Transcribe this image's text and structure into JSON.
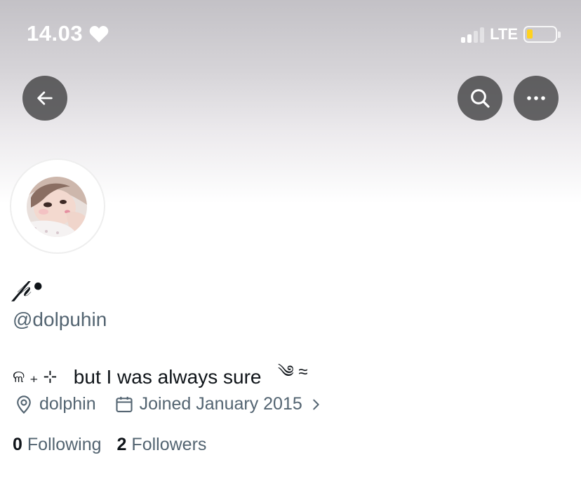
{
  "status_bar": {
    "time": "14.03",
    "network": "LTE",
    "battery_color": "#ffd21f"
  },
  "nav": {
    "back_icon": "arrow-left-icon",
    "search_icon": "search-icon",
    "more_icon": "more-horizontal-icon"
  },
  "profile": {
    "display_name": "𝓅•",
    "handle": "@dolpuhin",
    "bio_prefix": "ଳ ₊ ⊹",
    "bio_text": "but I was always sure",
    "bio_suffix": "༄ ≈",
    "location": "dolphin",
    "joined": "Joined January 2015",
    "following_count": "0",
    "following_label": "Following",
    "followers_count": "2",
    "followers_label": "Followers"
  },
  "colors": {
    "secondary_text": "#536471",
    "primary_text": "#0f1419",
    "button_bg": "#3c3c3e"
  }
}
